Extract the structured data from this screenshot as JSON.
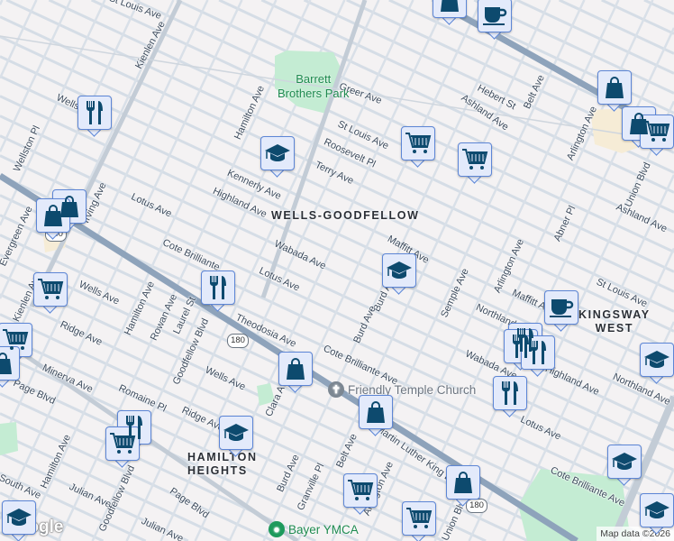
{
  "streets": [
    "St Louis Ave",
    "Kienlen Ave",
    "Wellsman",
    "Hamilton Ave",
    "Greer Ave",
    "Hebert St",
    "Belt Ave",
    "Ashland Ave",
    "St Louis Ave",
    "Roosevelt Pl",
    "Terry Ave",
    "Kennerly Ave",
    "Highland Ave",
    "Lotus Ave",
    "Wellston Pl",
    "Evergreen Ave",
    "Irving Ave",
    "Cote Brilliante",
    "Wabada Ave",
    "Lotus Ave",
    "Maffitt Ave",
    "Burd Ave",
    "Burd Ave",
    "Semple Ave",
    "Arlington Ave",
    "Abner Pl",
    "Arlington Ave",
    "Union Blvd",
    "Ashland Ave",
    "St Louis Ave",
    "Maffitt Ave",
    "Northland Ave",
    "Highland Ave",
    "Northland Ave",
    "Wabada Ave",
    "Cote Brilliante Ave",
    "Lotus Ave",
    "Cote Brilliante Ave",
    "Dr Martin Luther King Dr",
    "Belt Ave",
    "Arlington Ave",
    "Union Blvd",
    "Theodosia Ave",
    "Wells Ave",
    "Ridge Ave",
    "Hamilton Ave",
    "Rowan Ave",
    "Laurel St",
    "Goodfellow Blvd",
    "Wells Ave",
    "Minerva Ave",
    "Romaine Pl",
    "Ridge Ave",
    "Clara Ave",
    "Page Blvd",
    "Page Blvd",
    "Hamilton Ave",
    "Julian Ave",
    "Goodfellow Blvd",
    "Burd Ave",
    "Granville Pl",
    "South Ave",
    "Julian Ave",
    "Kienlen Ave"
  ],
  "neighborhoods": {
    "wells_goodfellow": "WELLS-GOODFELLOW",
    "kingsway_1": "KINGSWAY",
    "kingsway_2": "WEST",
    "hamilton_1": "HAMILTON",
    "hamilton_2": "HEIGHTS"
  },
  "park": {
    "line1": "Barrett",
    "line2": "Brothers Park"
  },
  "pois": {
    "church": "Friendly Temple Church",
    "ymca": "Bayer YMCA"
  },
  "route_shield": "180",
  "footer": {
    "logo": "Google",
    "attribution": "Map data ©2026"
  },
  "markers": [
    "shopping",
    "coffee",
    "restaurant",
    "education",
    "shopping",
    "shopping",
    "cart",
    "cart",
    "shopping",
    "shopping",
    "cart",
    "education",
    "restaurant",
    "cart",
    "cart",
    "shopping",
    "shopping",
    "coffee",
    "restaurant",
    "restaurant",
    "restaurant",
    "shopping",
    "cart",
    "restaurant",
    "restaurant",
    "education",
    "education",
    "education",
    "shopping",
    "cart",
    "cart",
    "education",
    "education"
  ],
  "colors": {
    "marker_icon": "#0d4a6e",
    "marker_bg": "#e3eafb",
    "park": "#c4ecd3",
    "major_road": "#8ea3bb",
    "street": "#d5dde6"
  }
}
